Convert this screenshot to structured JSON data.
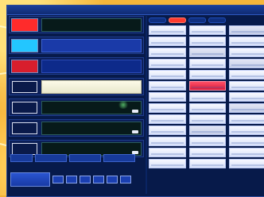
{
  "background": {
    "colors": {
      "desktop": "#f3b238",
      "window": "#071a4a",
      "accent": "#ff3b2f"
    }
  },
  "window": {
    "title": "",
    "icons": {
      "close": "close-icon"
    }
  },
  "left_panel": {
    "strips": [
      {
        "swatch_color": "#ff2b2b",
        "style": "dark"
      },
      {
        "swatch_color": "#23c6ff",
        "style": "blue"
      },
      {
        "swatch_color": "#d81e2d",
        "style": "navy"
      },
      {
        "swatch_color": "#ffffff",
        "style": "light"
      },
      {
        "swatch_color": "#0a1a4a",
        "style": "dark"
      },
      {
        "swatch_color": "#0a1a4a",
        "style": "dark"
      },
      {
        "swatch_color": "#0a1a4a",
        "style": "dark"
      }
    ],
    "controls": [
      "",
      "",
      "",
      ""
    ],
    "bottom_buttons": [
      "",
      "",
      "",
      "",
      "",
      ""
    ]
  },
  "right_panel": {
    "tabs": [
      "",
      "",
      "",
      ""
    ],
    "active_tab_index": 1,
    "grid_rows": 13,
    "grid_cols": 3
  }
}
